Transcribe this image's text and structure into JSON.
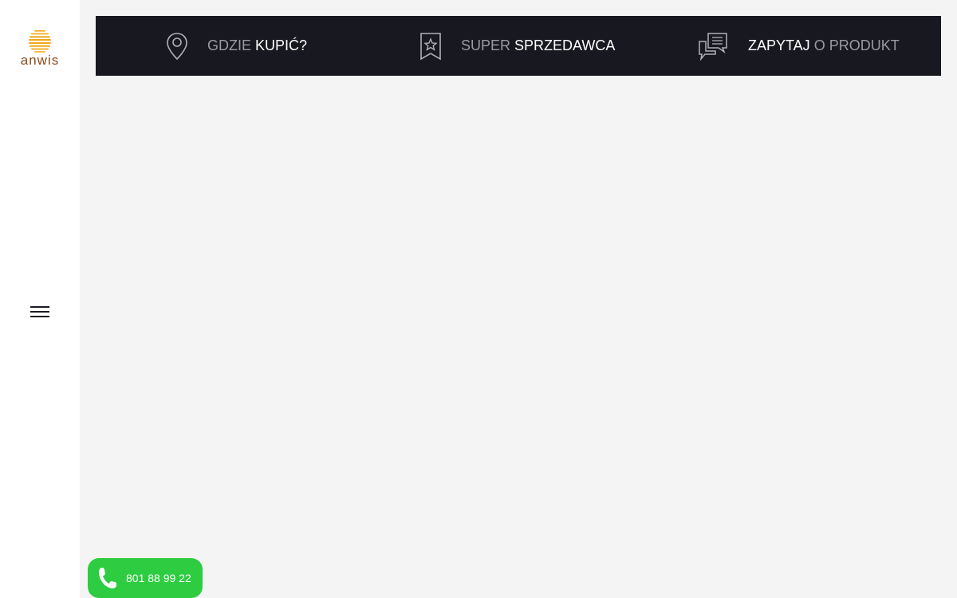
{
  "brand": {
    "logo_text": "anwis",
    "logo_color": "#8a4a1c",
    "mark_color": "#f0a818"
  },
  "sidebar": {
    "menu_icon": "hamburger-icon"
  },
  "topbar": {
    "background": "#181820",
    "items": [
      {
        "icon": "map-pin-icon",
        "dim_text": "GDZIE",
        "bright_text": "KUPIĆ?"
      },
      {
        "icon": "bookmark-star-icon",
        "dim_text": "SUPER",
        "bright_text": "SPRZEDAWCA"
      },
      {
        "icon": "chat-bubbles-icon",
        "bright_text": "ZAPYTAJ",
        "dim_text": "O PRODUKT"
      }
    ]
  },
  "phone": {
    "icon": "phone-icon",
    "number": "801 88 99 22",
    "color": "#2ecc40"
  }
}
